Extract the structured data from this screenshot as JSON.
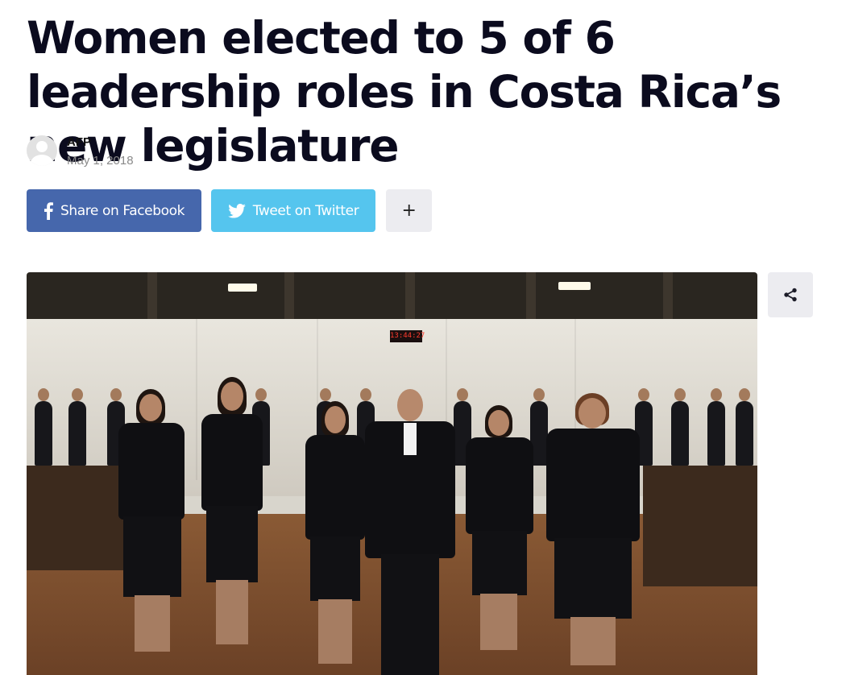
{
  "article": {
    "headline": "Women elected to 5 of 6 leadership roles in Costa Rica’s new legislature",
    "author": "AFP",
    "date": "May 1, 2018"
  },
  "share": {
    "facebook_label": "Share on Facebook",
    "twitter_label": "Tweet on Twitter",
    "more_label": "+"
  },
  "photo": {
    "clock_text": "13:44:27"
  },
  "icons": {
    "facebook": "facebook-icon",
    "twitter": "twitter-icon",
    "share": "share-icon",
    "avatar": "user-avatar-icon"
  },
  "colors": {
    "facebook": "#4667ac",
    "twitter": "#55c5ee",
    "neutral_button": "#ececf0",
    "headline": "#0b0b1e",
    "date": "#8a8a8a"
  }
}
